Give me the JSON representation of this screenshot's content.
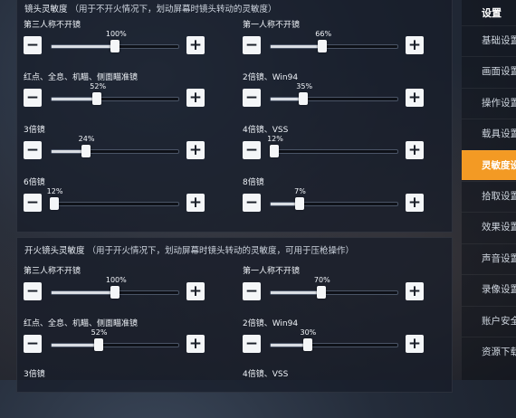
{
  "sections": [
    {
      "title": "镜头灵敏度",
      "note": "（用于不开火情况下，划动屏幕时镜头转动的灵敏度）",
      "items": [
        {
          "label": "第三人称不开镜",
          "value": "100%",
          "fraction": 0.5
        },
        {
          "label": "第一人称不开镜",
          "value": "66%",
          "fraction": 0.41
        },
        {
          "label": "红点、全息、机瞄、侧面瞄准镜",
          "value": "52%",
          "fraction": 0.36
        },
        {
          "label": "2倍镜、Win94",
          "value": "35%",
          "fraction": 0.26
        },
        {
          "label": "3倍镜",
          "value": "24%",
          "fraction": 0.27
        },
        {
          "label": "4倍镜、VSS",
          "value": "12%",
          "fraction": 0.03
        },
        {
          "label": "6倍镜",
          "value": "12%",
          "fraction": 0.02
        },
        {
          "label": "8倍镜",
          "value": "7%",
          "fraction": 0.23
        }
      ]
    },
    {
      "title": "开火镜头灵敏度",
      "note": "（用于开火情况下，划动屏幕时镜头转动的灵敏度，可用于压枪操作）",
      "items": [
        {
          "label": "第三人称不开镜",
          "value": "100%",
          "fraction": 0.5
        },
        {
          "label": "第一人称不开镜",
          "value": "70%",
          "fraction": 0.4
        },
        {
          "label": "红点、全息、机瞄、侧面瞄准镜",
          "value": "52%",
          "fraction": 0.37
        },
        {
          "label": "2倍镜、Win94",
          "value": "30%",
          "fraction": 0.29
        },
        {
          "label": "3倍镜",
          "value": "",
          "fraction": null
        },
        {
          "label": "4倍镜、VSS",
          "value": "",
          "fraction": null
        }
      ]
    }
  ],
  "controls": {
    "minus": "−",
    "plus": "+"
  },
  "sidebar": {
    "header": "设置",
    "items": [
      {
        "label": "基础设置",
        "active": false
      },
      {
        "label": "画面设置",
        "active": false
      },
      {
        "label": "操作设置",
        "active": false
      },
      {
        "label": "载具设置",
        "active": false
      },
      {
        "label": "灵敏度设置",
        "active": true
      },
      {
        "label": "拾取设置",
        "active": false
      },
      {
        "label": "效果设置",
        "active": false
      },
      {
        "label": "声音设置",
        "active": false
      },
      {
        "label": "录像设置",
        "active": false
      },
      {
        "label": "账户安全",
        "active": false
      },
      {
        "label": "资源下载",
        "active": false
      }
    ]
  },
  "colors": {
    "accent": "#f39a24",
    "button": "#f4f6f8"
  }
}
